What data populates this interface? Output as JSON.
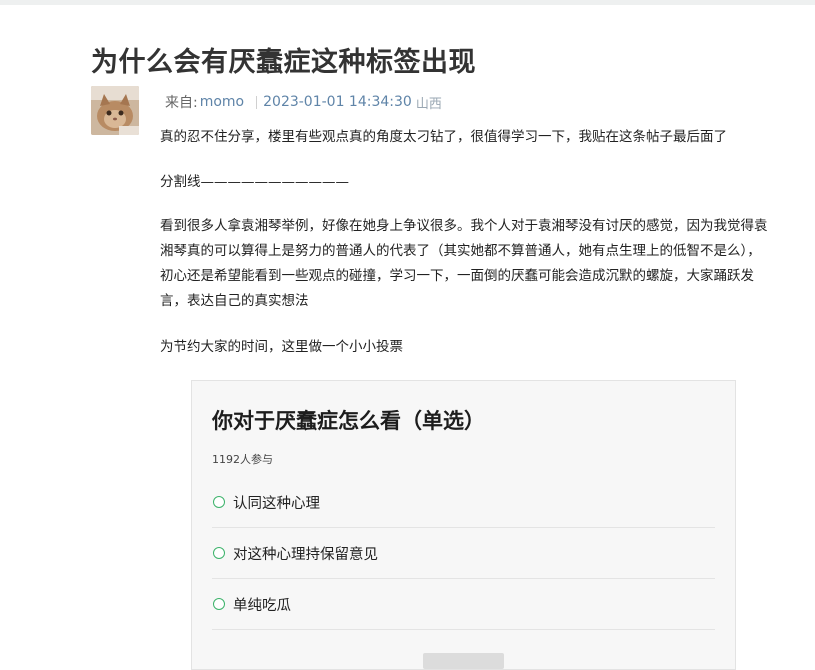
{
  "post": {
    "title": "为什么会有厌蠢症这种标签出现",
    "meta": {
      "source_label": "来自:",
      "author": "momo",
      "time": "2023-01-01 14:34:30",
      "region": "山西"
    },
    "paragraphs": [
      "真的忍不住分享，楼里有些观点真的角度太刁钻了，很值得学习一下，我贴在这条帖子最后面了",
      "分割线———————————",
      "看到很多人拿袁湘琴举例，好像在她身上争议很多。我个人对于袁湘琴没有讨厌的感觉，因为我觉得袁湘琴真的可以算得上是努力的普通人的代表了（其实她都不算普通人，她有点生理上的低智不是么），初心还是希望能看到一些观点的碰撞，学习一下，一面倒的厌蠢可能会造成沉默的螺旋，大家踊跃发言，表达自己的真实想法",
      "为节约大家的时间，这里做一个小小投票"
    ]
  },
  "poll": {
    "title": "你对于厌蠢症怎么看（单选）",
    "participants": "1192人参与",
    "options": [
      "认同这种心理",
      "对这种心理持保留意见",
      "单纯吃瓜"
    ]
  },
  "colors": {
    "accent_link": "#5f84a8",
    "radio_green": "#3db36b",
    "poll_bg": "#f7f7f7"
  }
}
